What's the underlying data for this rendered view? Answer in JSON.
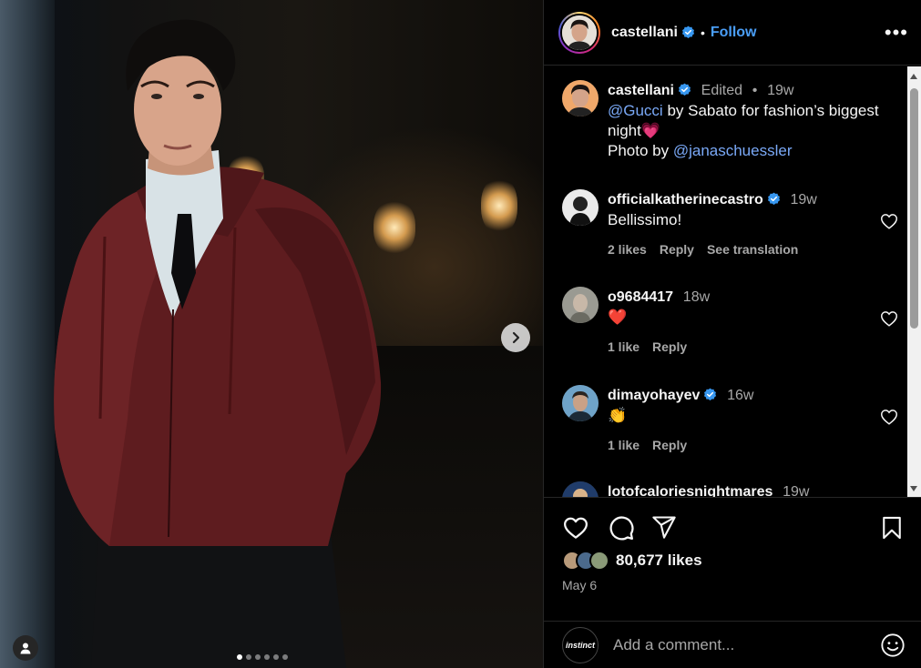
{
  "post": {
    "author": "castellani",
    "follow_label": "Follow",
    "separator": "•",
    "more_label": "•••",
    "caption": {
      "author": "castellani",
      "edited": "Edited",
      "dot": "•",
      "time": "19w",
      "mention1": "@Gucci",
      "text1": " by Sabato for fashion’s biggest night",
      "emoji": "💗",
      "text2": "Photo by ",
      "mention2": "@janaschuessler"
    },
    "comments": [
      {
        "user": "officialkatherinecastro",
        "verified": true,
        "time": "19w",
        "text": "Bellissimo!",
        "likes": "2 likes",
        "reply": "Reply",
        "translate": "See translation"
      },
      {
        "user": "o9684417",
        "verified": false,
        "time": "18w",
        "text": "❤️",
        "likes": "1 like",
        "reply": "Reply"
      },
      {
        "user": "dimayohayev",
        "verified": true,
        "time": "16w",
        "text": "👏",
        "likes": "1 like",
        "reply": "Reply"
      },
      {
        "user": "lotofcaloriesnightmares",
        "verified": false,
        "time": "19w"
      }
    ],
    "likes_count": "80,677 likes",
    "date": "May 6",
    "comment_placeholder": "Add a comment...",
    "commenter_avatar_text": "instinct",
    "carousel": {
      "count": 6,
      "active": 0
    }
  },
  "icons": {
    "like": "heart-icon",
    "comment": "comment-icon",
    "share": "send-icon",
    "save": "bookmark-icon",
    "next": "chevron-right-icon",
    "tags": "user-tag-icon",
    "emoji": "emoji-icon"
  },
  "colors": {
    "link": "#4a9ef7",
    "mention": "#7aa9f7",
    "verified": "#3797f0",
    "heart": "#ff3040"
  }
}
